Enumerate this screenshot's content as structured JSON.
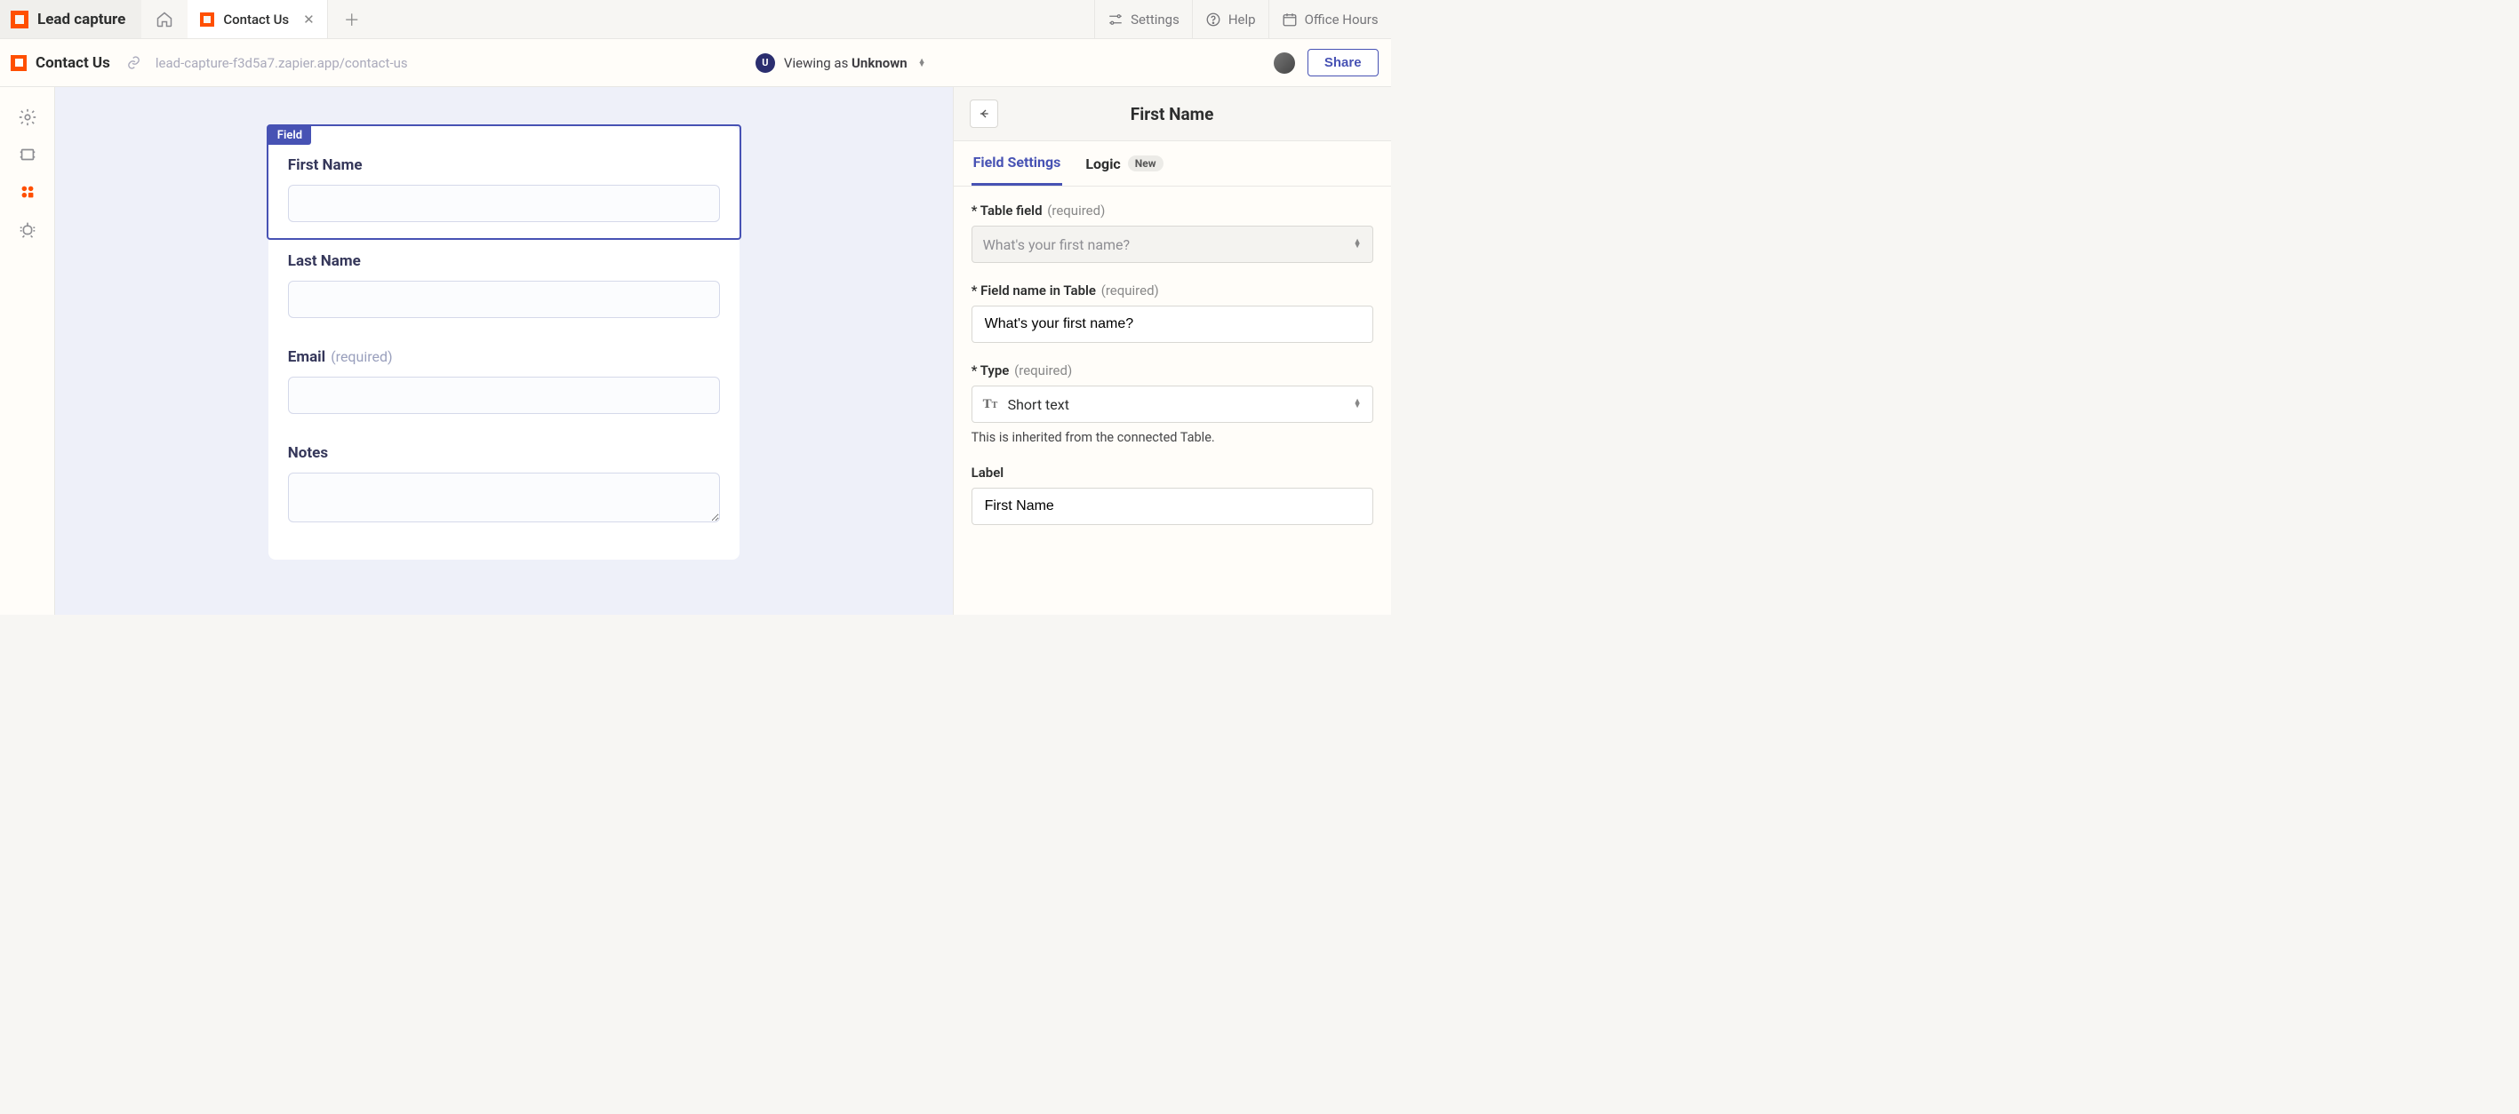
{
  "tabs": {
    "brand_title": "Lead capture",
    "page_title": "Contact Us",
    "actions": {
      "settings": "Settings",
      "help": "Help",
      "office_hours": "Office Hours"
    }
  },
  "context": {
    "page_name": "Contact Us",
    "url": "lead-capture-f3d5a7.zapier.app/contact-us",
    "viewing_prefix": "Viewing as ",
    "viewing_identity": "Unknown",
    "u_badge": "U",
    "share": "Share"
  },
  "form": {
    "selected_tag": "Field",
    "fields": [
      {
        "label": "First Name",
        "required": false,
        "type": "text",
        "selected": true
      },
      {
        "label": "Last Name",
        "required": false,
        "type": "text",
        "selected": false
      },
      {
        "label": "Email",
        "required": true,
        "type": "text",
        "selected": false
      },
      {
        "label": "Notes",
        "required": false,
        "type": "textarea",
        "selected": false
      }
    ],
    "required_hint": "(required)"
  },
  "settings": {
    "title": "First Name",
    "tabs": {
      "field_settings": "Field Settings",
      "logic": "Logic",
      "new_badge": "New"
    },
    "table_field": {
      "label": "Table field",
      "required": "(required)",
      "value": "What's your first name?"
    },
    "field_name": {
      "label": "Field name in Table",
      "required": "(required)",
      "value": "What's your first name?"
    },
    "type": {
      "label": "Type",
      "required": "(required)",
      "value": "Short text",
      "helper": "This is inherited from the connected Table."
    },
    "label_field": {
      "label": "Label",
      "value": "First Name"
    }
  }
}
